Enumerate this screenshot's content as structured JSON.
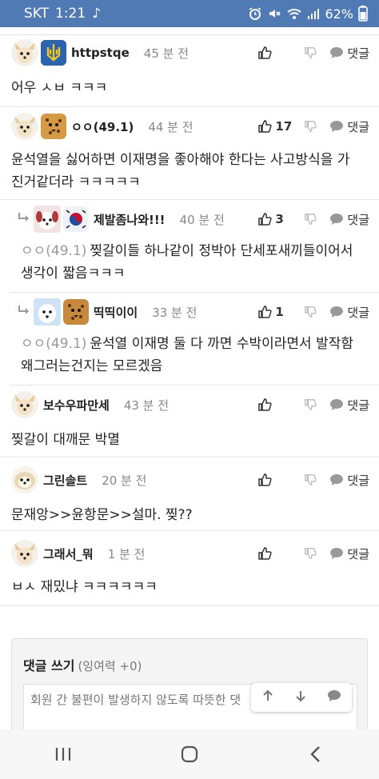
{
  "status": {
    "carrier": "SKT",
    "time": "1:21",
    "battery": "62%",
    "icons": [
      "music-note-icon",
      "alarm-icon",
      "mute-icon",
      "wifi-icon",
      "signal-icon",
      "battery-icon"
    ]
  },
  "actions": {
    "reply_label": "댓글"
  },
  "comments": [
    {
      "nick": "httpstqe",
      "time": "45 분 전",
      "likes": "",
      "text": "어우 ㅅㅂ ㅋㅋㅋ",
      "reply": false
    },
    {
      "nick": "ㅇㅇ(49.1)",
      "time": "44 분 전",
      "likes": "17",
      "text_l1": "윤석열을 싫어하면 이재명을 좋아해야 한다는 사고방식을 가",
      "text_l2": "진거같더라 ㅋㅋㅋㅋㅋ",
      "reply": false
    },
    {
      "nick": "제발좀나와!!!",
      "time": "40 분 전",
      "likes": "3",
      "mention": "ㅇㅇ(49.1)",
      "text_l1": "찢갈이들 하나같이 정박아 단세포새끼들이어서",
      "text_l2": "생각이 짧음ㅋㅋㅋ",
      "reply": true
    },
    {
      "nick": "띡띡이이",
      "time": "33 분 전",
      "likes": "1",
      "mention": "ㅇㅇ(49.1)",
      "text_l1": "윤석열 이재명 둘 다 까면 수박이라면서 발작함",
      "text_l2": "왜그러는건지는 모르겠음",
      "reply": true
    },
    {
      "nick": "보수우파만세",
      "time": "43 분 전",
      "likes": "",
      "text": "찢갈이 대깨문 박멸",
      "reply": false
    },
    {
      "nick": "그린솔트",
      "time": "20 분 전",
      "likes": "",
      "text": "문재앙>>윤항문>>설마. 찢??",
      "reply": false
    },
    {
      "nick": "그래서_뭐",
      "time": "1 분 전",
      "likes": "",
      "text": "ㅂㅅ 재밌냐 ㅋㅋㅋㅋㅋㅋ",
      "reply": false
    }
  ],
  "write": {
    "title": "댓글 쓰기",
    "subtitle": "(잉여력 +0)",
    "placeholder": "회원 간 불편이 발생하지 않도록 따뜻한 댓"
  },
  "colors": {
    "statusbar": "#4f7ab3",
    "reply_arrow": "#999999"
  }
}
